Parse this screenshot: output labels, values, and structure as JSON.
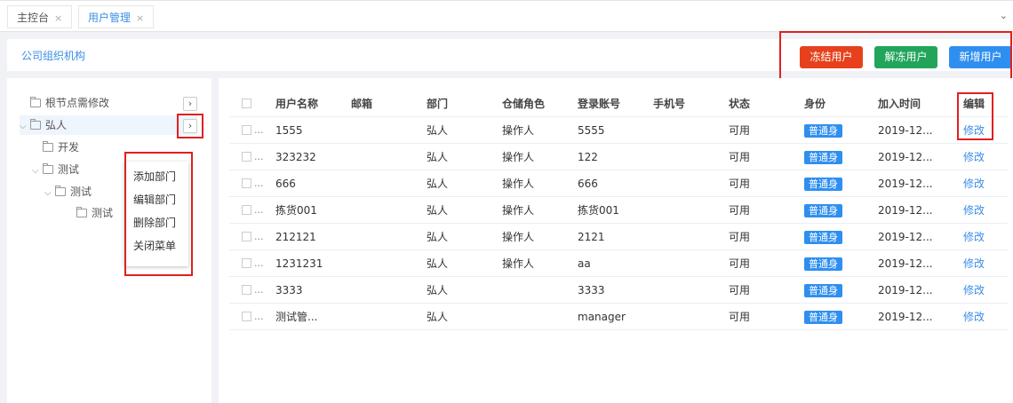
{
  "tabs": [
    {
      "label": "主控台",
      "active": false
    },
    {
      "label": "用户管理",
      "active": true
    }
  ],
  "tab_close_glyph": "×",
  "tab_more_glyph": "⌄",
  "breadcrumb": {
    "title": "公司组织机构"
  },
  "toolbar": {
    "freeze_label": "冻结用户",
    "unfreeze_label": "解冻用户",
    "new_label": "新增用户"
  },
  "tree": {
    "nodes": [
      {
        "label": "根节点需修改"
      },
      {
        "label": "弘人"
      },
      {
        "label": "开发"
      },
      {
        "label": "测试"
      },
      {
        "label": "测试"
      },
      {
        "label": "测试"
      }
    ],
    "arrow_glyph": "›"
  },
  "context_menu": {
    "items": [
      "添加部门",
      "编辑部门",
      "删除部门",
      "关闭菜单"
    ]
  },
  "table": {
    "headers": [
      "用户名称",
      "邮箱",
      "部门",
      "仓储角色",
      "登录账号",
      "手机号",
      "状态",
      "身份",
      "加入时间",
      "编辑"
    ],
    "rows": [
      {
        "name": "1555",
        "email": "",
        "dept": "弘人",
        "role": "操作人",
        "account": "5555",
        "phone": "",
        "status": "可用",
        "identity": "普通身",
        "joined": "2019-12...",
        "edit": "修改"
      },
      {
        "name": "323232",
        "email": "",
        "dept": "弘人",
        "role": "操作人",
        "account": "122",
        "phone": "",
        "status": "可用",
        "identity": "普通身",
        "joined": "2019-12...",
        "edit": "修改"
      },
      {
        "name": "666",
        "email": "",
        "dept": "弘人",
        "role": "操作人",
        "account": "666",
        "phone": "",
        "status": "可用",
        "identity": "普通身",
        "joined": "2019-12...",
        "edit": "修改"
      },
      {
        "name": "拣货001",
        "email": "",
        "dept": "弘人",
        "role": "操作人",
        "account": "拣货001",
        "phone": "",
        "status": "可用",
        "identity": "普通身",
        "joined": "2019-12...",
        "edit": "修改"
      },
      {
        "name": "212121",
        "email": "",
        "dept": "弘人",
        "role": "操作人",
        "account": "2121",
        "phone": "",
        "status": "可用",
        "identity": "普通身",
        "joined": "2019-12...",
        "edit": "修改"
      },
      {
        "name": "1231231",
        "email": "",
        "dept": "弘人",
        "role": "操作人",
        "account": "aa",
        "phone": "",
        "status": "可用",
        "identity": "普通身",
        "joined": "2019-12...",
        "edit": "修改"
      },
      {
        "name": "3333",
        "email": "",
        "dept": "弘人",
        "role": "",
        "account": "3333",
        "phone": "",
        "status": "可用",
        "identity": "普通身",
        "joined": "2019-12...",
        "edit": "修改"
      },
      {
        "name": "测试管...",
        "email": "",
        "dept": "弘人",
        "role": "",
        "account": "manager",
        "phone": "",
        "status": "可用",
        "identity": "普通身",
        "joined": "2019-12...",
        "edit": "修改"
      }
    ],
    "row_ellipsis": "..."
  },
  "colors": {
    "accent": "#3a8ee6",
    "freeze": "#e6411c",
    "unfreeze": "#22a55b",
    "new": "#2f8ff0",
    "annotation": "#e02020"
  }
}
